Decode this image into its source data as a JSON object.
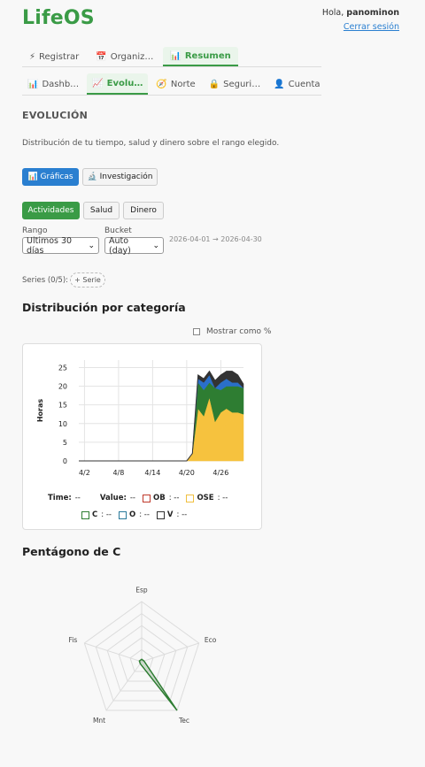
{
  "app": {
    "title": "LifeOS"
  },
  "user": {
    "greeting": "Hola,",
    "name": "panominon",
    "logout": "Cerrar sesión"
  },
  "main_tabs": [
    {
      "icon": "⚡",
      "label": "Registrar",
      "active": false
    },
    {
      "icon": "📅",
      "label": "Organiz…",
      "active": false
    },
    {
      "icon": "📊",
      "label": "Resumen",
      "active": true
    }
  ],
  "sub_tabs": [
    {
      "icon": "📊",
      "label": "Dashb…",
      "active": false
    },
    {
      "icon": "📈",
      "label": "Evolu…",
      "active": true
    },
    {
      "icon": "🧭",
      "label": "Norte",
      "active": false
    },
    {
      "icon": "🔒",
      "label": "Seguri…",
      "active": false
    },
    {
      "icon": "👤",
      "label": "Cuenta",
      "active": false
    }
  ],
  "section": {
    "title": "EVOLUCIÓN",
    "description": "Distribución de tu tiempo, salud y dinero sobre el rango elegido."
  },
  "view_buttons": {
    "charts": "📊 Gráficas",
    "research": "🔬 Investigación"
  },
  "domain_buttons": {
    "activities": "Actividades",
    "health": "Salud",
    "money": "Dinero"
  },
  "controls": {
    "range_label": "Rango",
    "range_value": "Ultimos 30 días",
    "bucket_label": "Bucket",
    "bucket_value": "Auto (day)",
    "date_range": "2026-04-01 → 2026-04-30"
  },
  "series": {
    "label": "Series (0/5):",
    "add": "+ Serie"
  },
  "distribution": {
    "title": "Distribución por categoría",
    "percent_toggle": "Mostrar como %"
  },
  "legend": {
    "time_label": "Time:",
    "time_value": "--",
    "value_label": "Value:",
    "value_value": "--",
    "items": [
      {
        "key": "OB",
        "value": "--",
        "color": "#c0392b"
      },
      {
        "key": "OSE",
        "value": "--",
        "color": "#f0c040"
      },
      {
        "key": "C",
        "value": "--",
        "color": "#2e7d32"
      },
      {
        "key": "O",
        "value": "--",
        "color": "#2a7a9b"
      },
      {
        "key": "V",
        "value": "--",
        "color": "#333333"
      }
    ]
  },
  "chart_data": [
    {
      "type": "area",
      "title": "",
      "ylabel": "Horas",
      "xlabel": "",
      "x_ticks": [
        "4/2",
        "4/8",
        "4/14",
        "4/20",
        "4/26"
      ],
      "y_ticks": [
        0,
        5,
        10,
        15,
        20,
        25
      ],
      "ylim": [
        0,
        27
      ],
      "x": [
        "4/1",
        "4/2",
        "4/3",
        "4/4",
        "4/5",
        "4/6",
        "4/7",
        "4/8",
        "4/9",
        "4/10",
        "4/11",
        "4/12",
        "4/13",
        "4/14",
        "4/15",
        "4/16",
        "4/17",
        "4/18",
        "4/19",
        "4/20",
        "4/21",
        "4/22",
        "4/23",
        "4/24",
        "4/25",
        "4/26",
        "4/27",
        "4/28",
        "4/29",
        "4/30"
      ],
      "series": [
        {
          "name": "OSE",
          "color": "#f6c23e",
          "values": [
            0,
            0,
            0,
            0,
            0,
            0,
            0,
            0,
            0,
            0,
            0,
            0,
            0,
            0,
            0,
            0,
            0,
            0,
            0,
            0,
            2,
            9,
            8,
            9,
            8.5,
            8,
            10,
            11,
            9,
            8.5
          ]
        },
        {
          "name": "",
          "color": "#f6c23e",
          "values": [
            0,
            0,
            0,
            0,
            0,
            0,
            0,
            0,
            0,
            0,
            0,
            0,
            0,
            0,
            0,
            0,
            0,
            0,
            0,
            0,
            0,
            5,
            4,
            8,
            2,
            5,
            4,
            2,
            4,
            4
          ]
        },
        {
          "name": "C",
          "color": "#2e7d32",
          "values": [
            0,
            0,
            0,
            0,
            0,
            0,
            0,
            0,
            0,
            0,
            0,
            0,
            0,
            0,
            0,
            0,
            0,
            0,
            0,
            0,
            0,
            7,
            7,
            4,
            9,
            6,
            6,
            7,
            7,
            7
          ]
        },
        {
          "name": "O",
          "color": "#2a6fc9",
          "values": [
            0,
            0,
            0,
            0,
            0,
            0,
            0,
            0,
            0,
            0,
            0,
            0,
            0,
            0,
            0,
            0,
            0,
            0,
            0,
            0,
            0,
            1,
            2,
            2,
            0,
            2,
            2,
            1,
            1,
            0
          ]
        },
        {
          "name": "V",
          "color": "#333333",
          "values": [
            0,
            0,
            0,
            0,
            0,
            0,
            0,
            0,
            0,
            0,
            0,
            0,
            0,
            0,
            0,
            0,
            0,
            0,
            0,
            0,
            0,
            1,
            1,
            1,
            2,
            2,
            2,
            3,
            2,
            1
          ]
        }
      ]
    },
    {
      "type": "radar",
      "title": "Pentágono de C",
      "axes": [
        "Esp",
        "Eco",
        "Tec",
        "Mnt",
        "Fis"
      ],
      "values": [
        0.04,
        0.04,
        1.0,
        0.04,
        0.04
      ],
      "color": "#2e7d32"
    }
  ]
}
